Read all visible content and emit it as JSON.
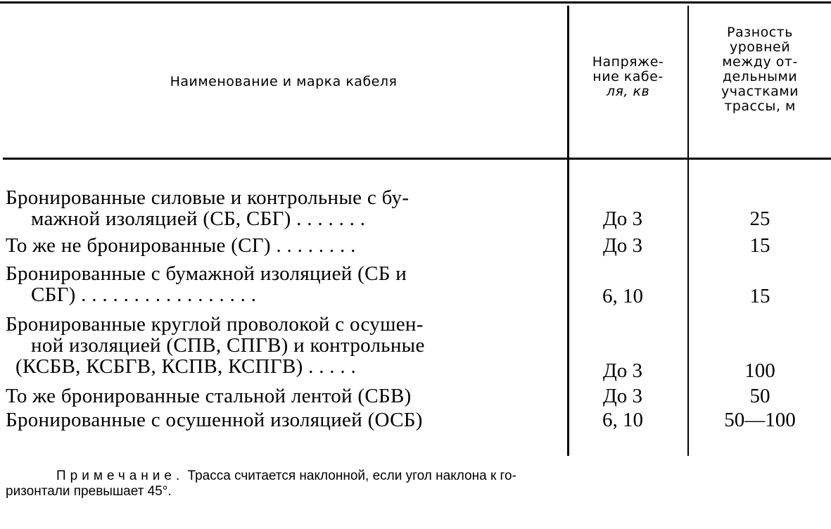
{
  "table": {
    "headers": {
      "name": "Наименование и марка кабеля",
      "voltage": [
        "Напряже-",
        "ние кабе-",
        "ля, кв"
      ],
      "level_difference": [
        "Разность",
        "уровней",
        "между от-",
        "дельными",
        "участками",
        "трассы, м"
      ]
    },
    "rows": [
      {
        "name_lines": [
          "Бронированные  силовые  и  контрольные с бу-",
          "мажной изоляцией (СБ, СБГ) . . . . . . ."
        ],
        "voltage": "До 3",
        "level_difference": "25"
      },
      {
        "name_lines": [
          "То же не бронированные (СГ) . . . . . . . ."
        ],
        "voltage": "До 3",
        "level_difference": "15"
      },
      {
        "name_lines": [
          "Бронированные  с бумажной  изоляцией  (СБ и",
          "СБГ)  . . . . . . . . . . . . . . . . ."
        ],
        "voltage": "6, 10",
        "level_difference": "15"
      },
      {
        "name_lines": [
          "Бронированные круглой  проволокой  с осушен-",
          "ной изоляцией (СПВ, СПГВ)  и контрольные",
          "(КСБВ, КСБГВ, КСПВ, КСПГВ) . . . . ."
        ],
        "voltage": "До 3",
        "level_difference": "100"
      },
      {
        "name_lines": [
          "То же бронированные  стальной  лентой  (СБВ)"
        ],
        "voltage": "До 3",
        "level_difference": "50"
      },
      {
        "name_lines": [
          "Бронированные с  осушенной  изоляцией (ОСБ)"
        ],
        "voltage": "6, 10",
        "level_difference": "50—100"
      }
    ]
  },
  "note": {
    "label": "Примечание.",
    "text_line1": "Трасса считается наклонной, если угол наклона к го-",
    "text_line2": "ризонтали превышает 45°."
  }
}
